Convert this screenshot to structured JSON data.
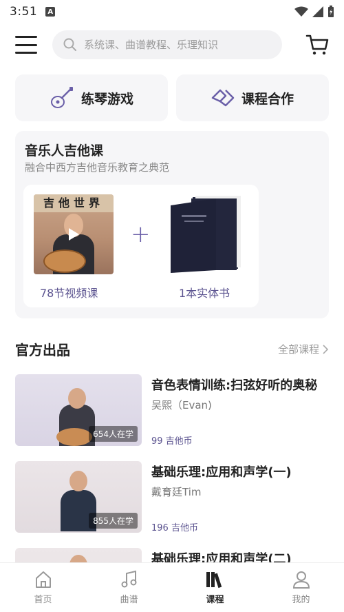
{
  "status": {
    "time": "3:51"
  },
  "header": {
    "search_placeholder": "系统课、曲谱教程、乐理知识"
  },
  "quick": [
    {
      "label": "练琴游戏",
      "icon": "guitar-icon"
    },
    {
      "label": "课程合作",
      "icon": "handshake-icon"
    }
  ],
  "course": {
    "title": "音乐人吉他课",
    "subtitle": "融合中西方吉他音乐教育之典范",
    "video_banner": "吉他世界",
    "video_label": "78节视频课",
    "book_label": "1本实体书"
  },
  "official": {
    "title": "官方出品",
    "more": "全部课程"
  },
  "items": [
    {
      "name": "音色表情训练:扫弦好听的奥秘",
      "author": "吴熙（Evan)",
      "price": "99 吉他币",
      "learners": "654人在学"
    },
    {
      "name": "基础乐理:应用和声学(一)",
      "author": "戴育廷Tim",
      "price": "196 吉他币",
      "learners": "855人在学"
    },
    {
      "name": "基础乐理:应用和声学(二)",
      "author": "",
      "price": "",
      "learners": ""
    }
  ],
  "tabs": [
    {
      "label": "首页",
      "icon": "home-icon"
    },
    {
      "label": "曲谱",
      "icon": "music-note-icon"
    },
    {
      "label": "课程",
      "icon": "books-icon",
      "active": true
    },
    {
      "label": "我的",
      "icon": "profile-icon"
    }
  ],
  "colors": {
    "accent": "#5c5490",
    "text": "#222222",
    "muted": "#888888"
  }
}
